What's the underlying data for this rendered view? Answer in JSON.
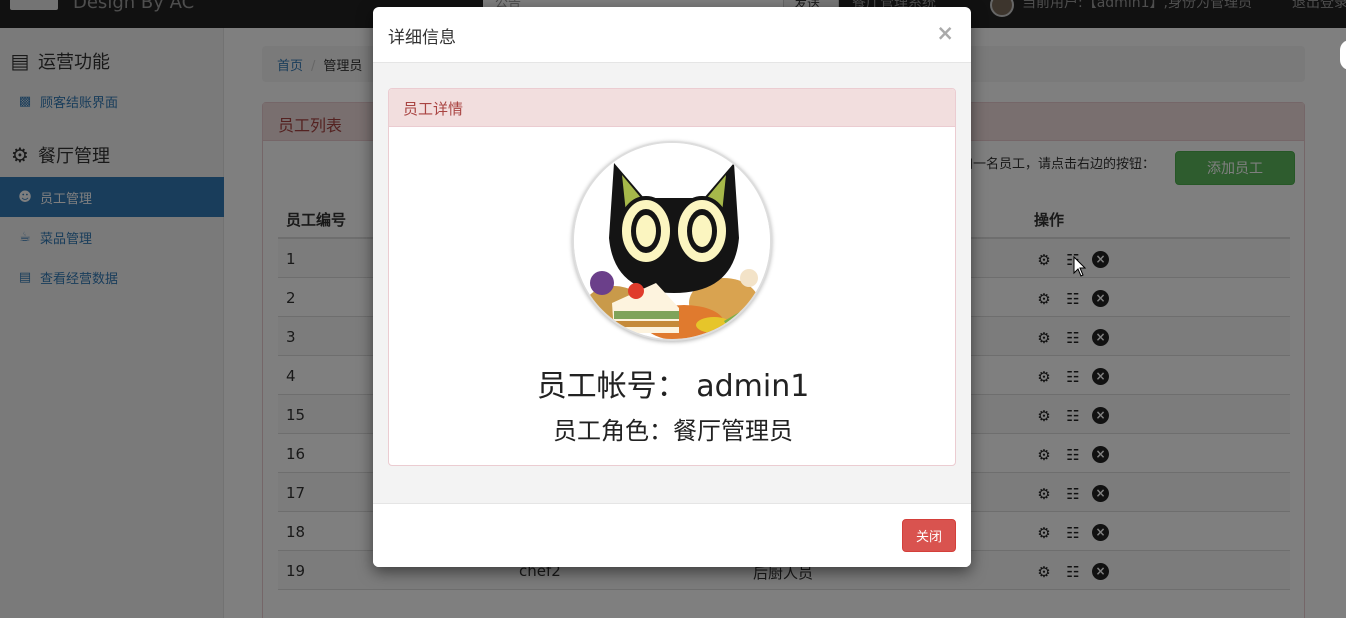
{
  "navbar": {
    "brand": "Design By AC",
    "search_placeholder": "公告",
    "send_label": "发送",
    "menu_link": "餐厅管理系统",
    "current_user": "当前用户:【admin1】,身份为管理员",
    "logout": "退出登录"
  },
  "sidebar": {
    "section1": "运营功能",
    "item_checkout": "顾客结账界面",
    "section2": "餐厅管理",
    "item_staff": "员工管理",
    "item_dishes": "菜品管理",
    "item_stats": "查看经营数据"
  },
  "breadcrumb": {
    "home": "首页",
    "sep": "/",
    "current": "管理员"
  },
  "panel": {
    "title": "员工列表",
    "add_hint": "加一名员工，请点击右边的按钮：",
    "add_button": "添加员工"
  },
  "table": {
    "headers": {
      "id": "员工编号",
      "ops": "操作"
    },
    "rows": [
      {
        "id": "1",
        "account": "",
        "role": ""
      },
      {
        "id": "2",
        "account": "",
        "role": ""
      },
      {
        "id": "3",
        "account": "",
        "role": ""
      },
      {
        "id": "4",
        "account": "",
        "role": ""
      },
      {
        "id": "15",
        "account": "",
        "role": ""
      },
      {
        "id": "16",
        "account": "",
        "role": ""
      },
      {
        "id": "17",
        "account": "",
        "role": ""
      },
      {
        "id": "18",
        "account": "",
        "role": ""
      },
      {
        "id": "19",
        "account": "chef2",
        "role": "后厨人员"
      }
    ]
  },
  "modal": {
    "title": "详细信息",
    "close_x": "×",
    "inner_title": "员工详情",
    "account_line": "员工帐号： admin1",
    "role_line": "员工角色：餐厅管理员",
    "close_button": "关闭"
  },
  "colors": {
    "primary": "#337ab7",
    "success": "#5cb85c",
    "danger": "#d9534f",
    "panel_heading_bg": "#f2dede",
    "panel_heading_text": "#a94442"
  },
  "icons": [
    "credit-card-icon",
    "money-icon",
    "gear-icon",
    "users-icon",
    "coffee-icon",
    "bar-chart-icon",
    "cogs-icon",
    "sitemap-icon",
    "remove-icon",
    "close-icon"
  ]
}
